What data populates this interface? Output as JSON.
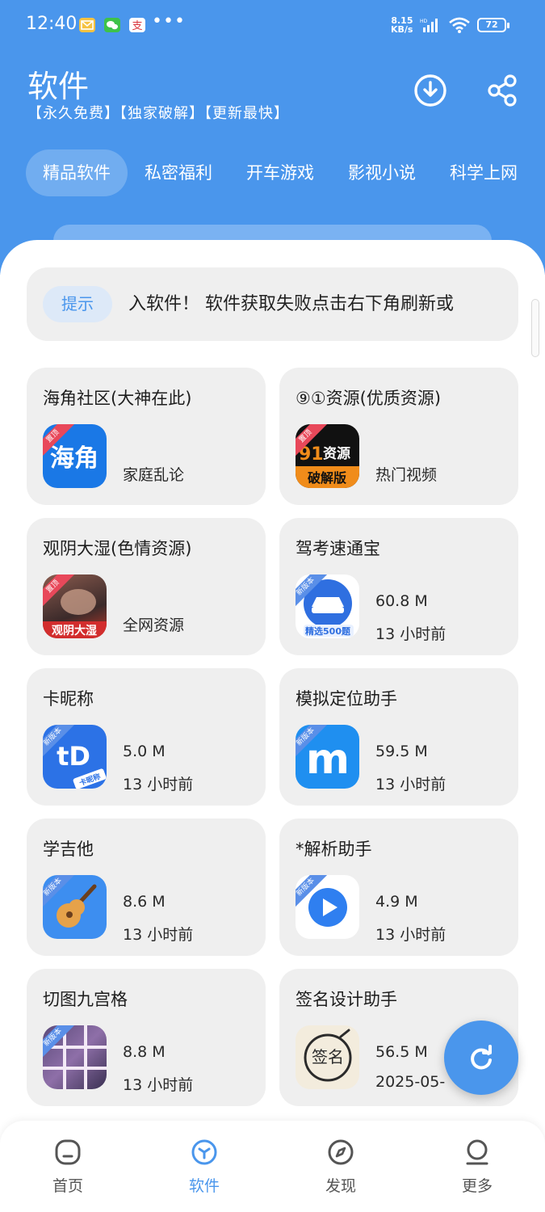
{
  "status_bar": {
    "time": "12:40",
    "speed_value": "8.15",
    "speed_unit": "KB/s",
    "battery": "72",
    "notification_icons": [
      "mail-icon",
      "wechat-icon",
      "alipay-icon"
    ]
  },
  "header": {
    "title": "软件",
    "subtitle": "【永久免费】【独家破解】【更新最快】",
    "download_icon": "download-icon",
    "share_icon": "share-icon"
  },
  "tabs": [
    {
      "label": "精品软件",
      "active": true
    },
    {
      "label": "私密福利",
      "active": false
    },
    {
      "label": "开车游戏",
      "active": false
    },
    {
      "label": "影视小说",
      "active": false
    },
    {
      "label": "科学上网",
      "active": false
    }
  ],
  "notice": {
    "badge": "提示",
    "text": "入软件！  软件获取失败点击右下角刷新或"
  },
  "apps": [
    {
      "name": "海角社区(大神在此)",
      "line1": "",
      "line2": "家庭乱论",
      "ribbon": "置顶",
      "icon_text": "海角",
      "icon": "haijiao-app-icon"
    },
    {
      "name": "⑨①资源(优质资源)",
      "line1": "",
      "line2": "热门视频",
      "ribbon": "置顶",
      "icon_text": "91资源",
      "icon_sub": "破解版",
      "icon": "91-resource-app-icon"
    },
    {
      "name": "观阴大湿(色情资源)",
      "line1": "",
      "line2": "全网资源",
      "ribbon": "置顶",
      "icon_text": "观阴大湿",
      "icon": "guanyin-app-icon"
    },
    {
      "name": "驾考速通宝",
      "line1": "60.8 M",
      "line2": "13 小时前",
      "ribbon": "新版本",
      "icon_text": "精选500题",
      "icon": "car-exam-app-icon"
    },
    {
      "name": "卡昵称",
      "line1": "5.0 M",
      "line2": "13 小时前",
      "ribbon": "新版本",
      "icon_text": "tD",
      "icon_sub": "卡昵称",
      "icon": "nickname-app-icon"
    },
    {
      "name": "模拟定位助手",
      "line1": "59.5 M",
      "line2": "13 小时前",
      "ribbon": "新版本",
      "icon_text": "m",
      "icon": "location-app-icon"
    },
    {
      "name": "学吉他",
      "line1": "8.6 M",
      "line2": "13 小时前",
      "ribbon": "新版本",
      "icon": "guitar-app-icon"
    },
    {
      "name": "*解析助手",
      "line1": "4.9 M",
      "line2": "13 小时前",
      "ribbon": "新版本",
      "icon": "video-parse-app-icon"
    },
    {
      "name": "切图九宫格",
      "line1": "8.8 M",
      "line2": "13 小时前",
      "ribbon": "新版本",
      "icon": "grid-cut-app-icon"
    },
    {
      "name": "签名设计助手",
      "line1": "56.5 M",
      "line2": "2025-05-",
      "ribbon": "",
      "icon_text": "签名",
      "icon": "signature-app-icon"
    }
  ],
  "fab": {
    "icon": "refresh-icon"
  },
  "nav": [
    {
      "label": "首页",
      "icon": "home-icon",
      "active": false
    },
    {
      "label": "软件",
      "icon": "cube-icon",
      "active": true
    },
    {
      "label": "发现",
      "icon": "compass-icon",
      "active": false
    },
    {
      "label": "更多",
      "icon": "user-icon",
      "active": false
    }
  ],
  "colors": {
    "primary": "#4a96ec",
    "card_bg": "#efefef",
    "ribbon_top": "#e8485a",
    "ribbon_new": "#5a8fe8"
  }
}
